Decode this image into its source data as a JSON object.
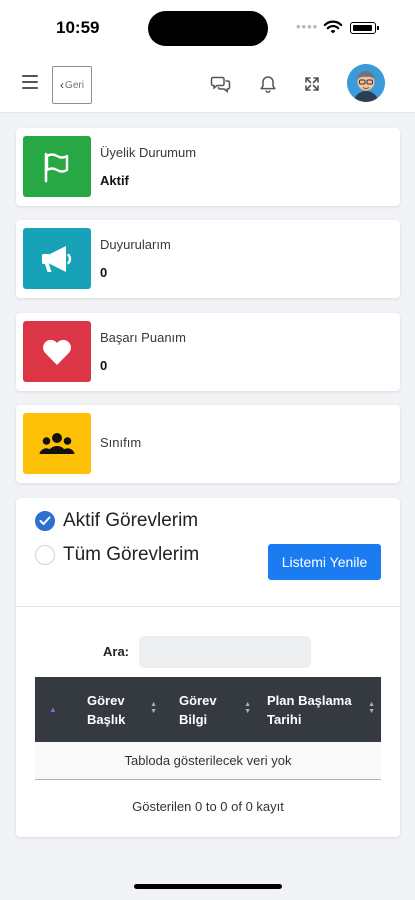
{
  "status_bar": {
    "time": "10:59"
  },
  "navbar": {
    "back_label": "Geri"
  },
  "info_cards": [
    {
      "label": "Üyelik Durumum",
      "value": "Aktif",
      "color": "#28a745",
      "icon": "flag-icon"
    },
    {
      "label": "Duyurularım",
      "value": "0",
      "color": "#17a2b8",
      "icon": "megaphone-icon"
    },
    {
      "label": "Başarı Puanım",
      "value": "0",
      "color": "#dc3545",
      "icon": "heart-icon"
    },
    {
      "label": "Sınıfım",
      "value": "",
      "color": "#ffc107",
      "icon": "users-icon"
    }
  ],
  "tasks": {
    "radio_active": "Aktif Görevlerim",
    "radio_all": "Tüm Görevlerim",
    "selected": "active",
    "refresh_label": "Listemi Yenile",
    "search_label": "Ara:",
    "search_value": "",
    "columns": [
      "Görev Başlık",
      "Görev Bilgi",
      "Plan Başlama Tarihi"
    ],
    "empty_text": "Tabloda gösterilecek veri yok",
    "info_text": "Gösterilen 0 to 0 of 0 kayıt"
  },
  "colors": {
    "accent": "#1a7cf0",
    "table_header": "#343a40"
  }
}
